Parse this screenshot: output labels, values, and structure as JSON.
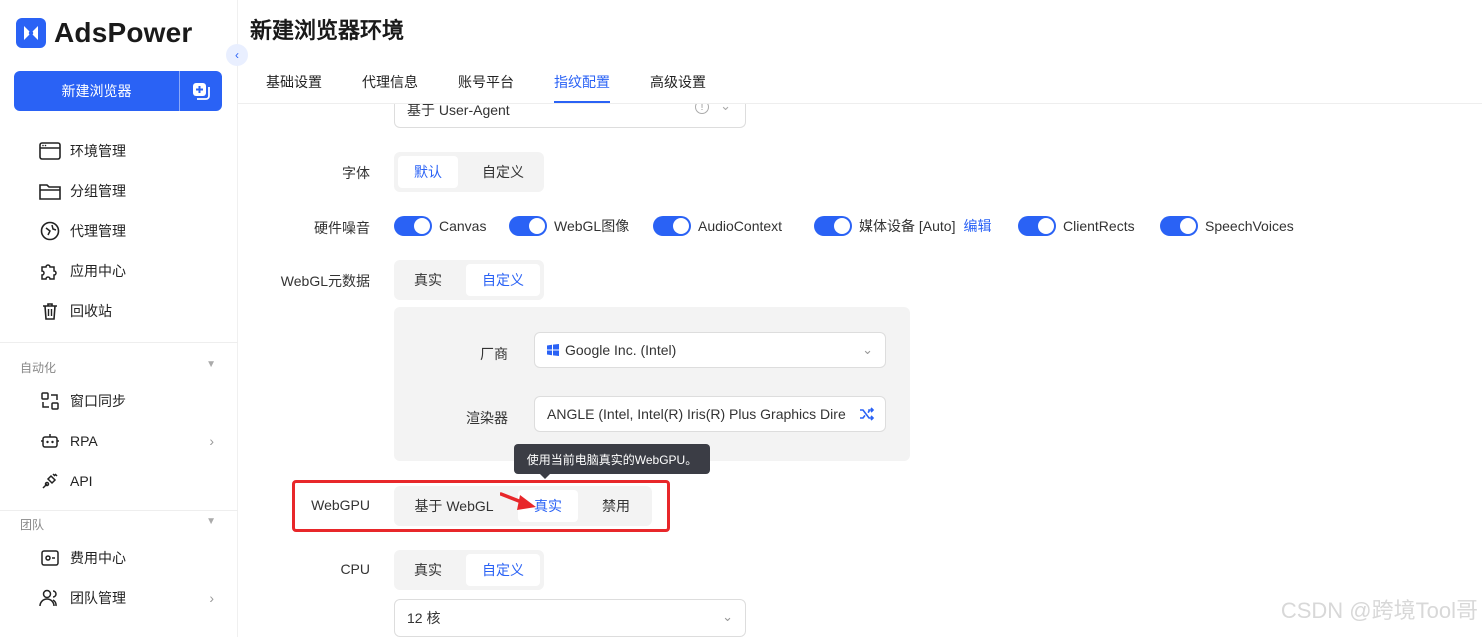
{
  "app": {
    "name": "AdsPower",
    "brand_color": "#2a62f5"
  },
  "sidebar": {
    "new_browser_label": "新建浏览器",
    "items_main": [
      {
        "label": "环境管理",
        "icon": "browser-window-icon"
      },
      {
        "label": "分组管理",
        "icon": "folder-icon"
      },
      {
        "label": "代理管理",
        "icon": "proxy-icon"
      },
      {
        "label": "应用中心",
        "icon": "puzzle-icon"
      },
      {
        "label": "回收站",
        "icon": "trash-icon"
      }
    ],
    "group_automation": "自动化",
    "items_automation": [
      {
        "label": "窗口同步",
        "icon": "sync-icon"
      },
      {
        "label": "RPA",
        "icon": "robot-icon"
      },
      {
        "label": "API",
        "icon": "plug-icon"
      }
    ],
    "group_team": "团队",
    "items_team": [
      {
        "label": "费用中心",
        "icon": "billing-icon"
      },
      {
        "label": "团队管理",
        "icon": "team-icon"
      }
    ]
  },
  "page": {
    "title": "新建浏览器环境",
    "tabs": [
      "基础设置",
      "代理信息",
      "账号平台",
      "指纹配置",
      "高级设置"
    ],
    "active_tab": "指纹配置"
  },
  "form": {
    "ua_select_value": "基于 User-Agent",
    "font": {
      "label": "字体",
      "options": [
        "默认",
        "自定义"
      ],
      "selected": "默认"
    },
    "hardware_noise": {
      "label": "硬件噪音",
      "toggles": [
        "Canvas",
        "WebGL图像",
        "AudioContext",
        "媒体设备 [Auto]",
        "ClientRects",
        "SpeechVoices"
      ],
      "edit_label": "编辑"
    },
    "webgl_meta": {
      "label": "WebGL元数据",
      "options": [
        "真实",
        "自定义"
      ],
      "selected": "自定义",
      "vendor_label": "厂商",
      "vendor_value": "Google Inc. (Intel)",
      "renderer_label": "渲染器",
      "renderer_value": "ANGLE (Intel, Intel(R) Iris(R) Plus Graphics Dire"
    },
    "webgpu": {
      "label": "WebGPU",
      "options": [
        "基于 WebGL",
        "真实",
        "禁用"
      ],
      "selected": "真实",
      "tooltip": "使用当前电脑真实的WebGPU。"
    },
    "cpu": {
      "label": "CPU",
      "options": [
        "真实",
        "自定义"
      ],
      "selected": "自定义",
      "select_value": "12 核"
    }
  },
  "watermark": "CSDN @跨境Tool哥",
  "annotation_color": "#e8272a"
}
